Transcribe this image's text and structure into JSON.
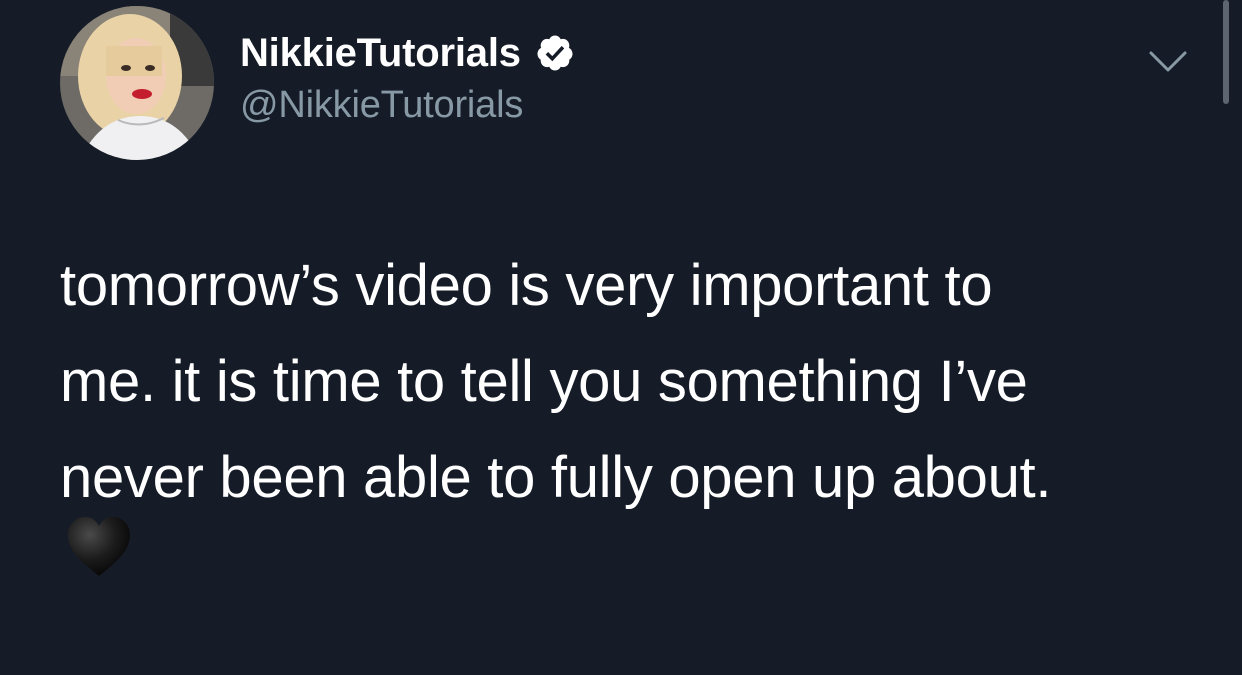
{
  "author": {
    "display_name": "NikkieTutorials",
    "handle": "@NikkieTutorials",
    "verified": true,
    "avatar_icon": "profile-photo"
  },
  "tweet": {
    "lines": [
      "tomorrow’s video is very important to",
      "me. it is time to tell you something I’ve",
      "never been able to fully open up about."
    ],
    "emoji": "🖤",
    "emoji_name": "black-heart"
  },
  "icons": {
    "verified": "verified-badge-icon",
    "more": "chevron-down-icon"
  },
  "colors": {
    "background": "#161c27",
    "text_primary": "#ffffff",
    "text_secondary": "#8899a6",
    "chevron": "#8899a6"
  }
}
